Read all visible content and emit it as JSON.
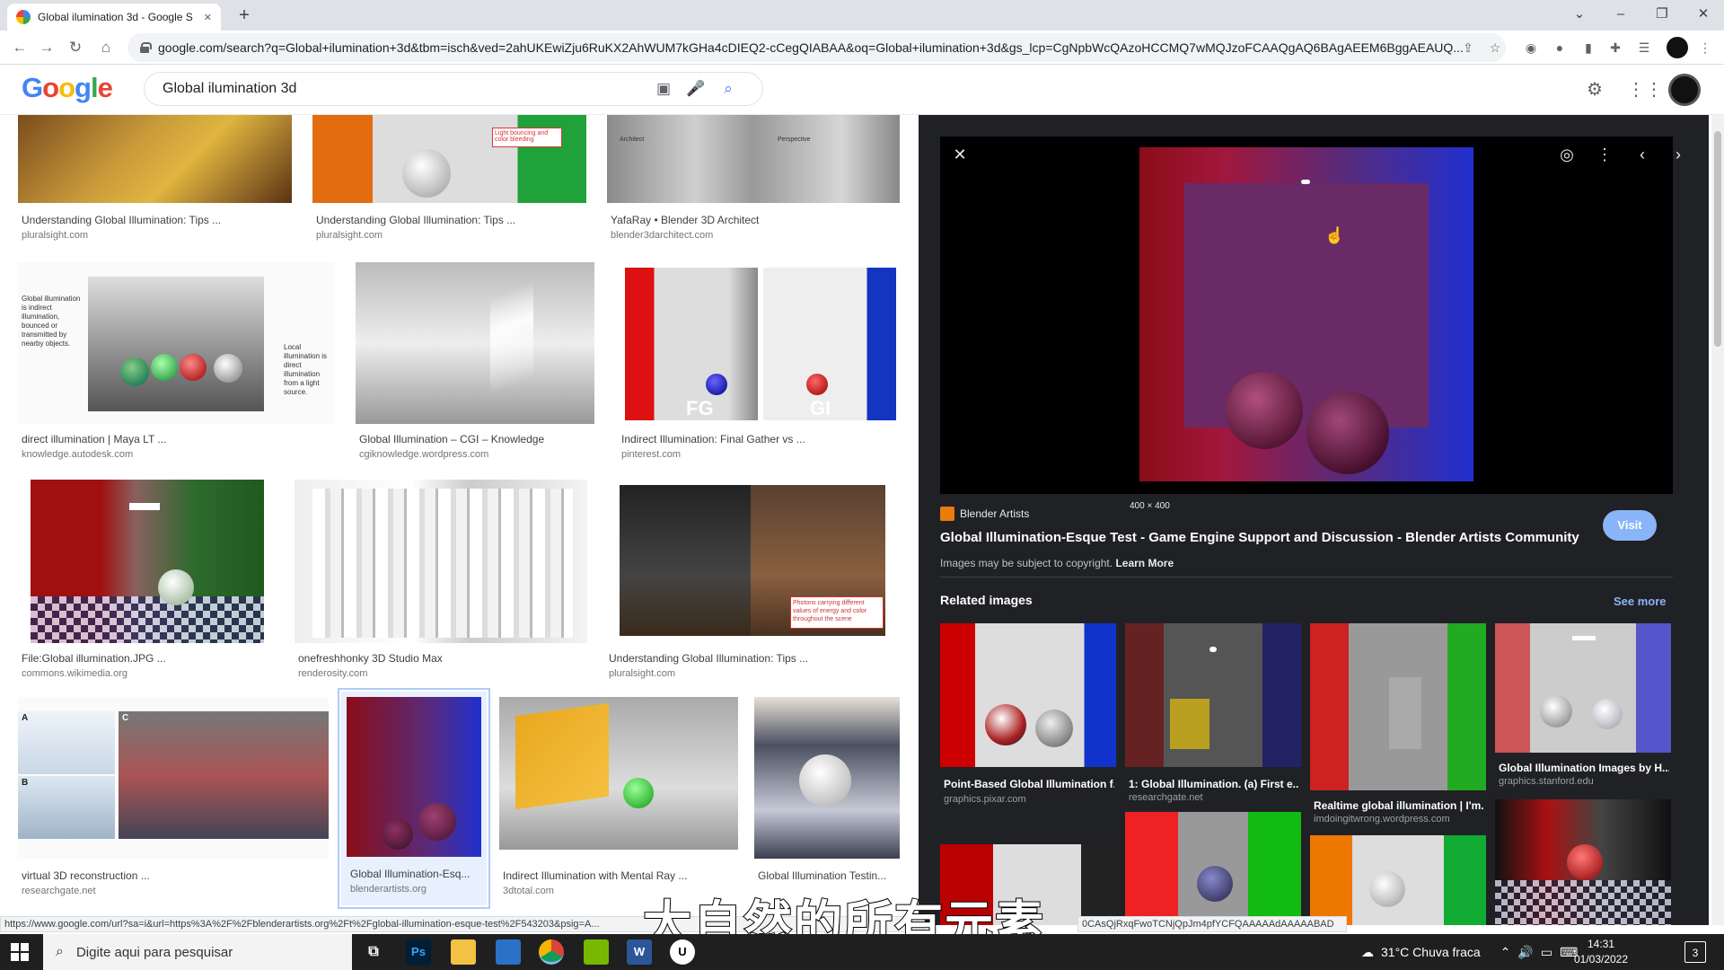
{
  "browser": {
    "tab_title": "Global ilumination 3d - Google S",
    "tab_close": "✕",
    "new_tab": "+",
    "url": "google.com/search?q=Global+ilumination+3d&tbm=isch&ved=2ahUKEwiZju6RuKX2AhWUM7kGHa4cDIEQ2-cCegQIABAA&oq=Global+ilumination+3d&gs_lcp=CgNpbWcQAzoHCCMQ7wMQJzoFCAAQgAQ6BAgAEEM6BggAEAUQ...",
    "window_controls": [
      "⌄",
      "–",
      "❐",
      "✕"
    ],
    "nav": [
      "←",
      "→",
      "↻",
      "⌂"
    ]
  },
  "google": {
    "logo_letters": [
      {
        "ch": "G",
        "color": "#4285f4"
      },
      {
        "ch": "o",
        "color": "#ea4335"
      },
      {
        "ch": "o",
        "color": "#fbbc05"
      },
      {
        "ch": "g",
        "color": "#4285f4"
      },
      {
        "ch": "l",
        "color": "#34a853"
      },
      {
        "ch": "e",
        "color": "#ea4335"
      }
    ],
    "query": "Global ilumination 3d"
  },
  "results": [
    {
      "title": "Understanding Global Illumination: Tips ...",
      "source": "pluralsight.com"
    },
    {
      "title": "Understanding Global Illumination: Tips ...",
      "source": "pluralsight.com"
    },
    {
      "title": "YafaRay • Blender 3D Architect",
      "source": "blender3darchitect.com"
    },
    {
      "title": "direct illumination | Maya LT ...",
      "source": "knowledge.autodesk.com"
    },
    {
      "title": "Global Illumination – CGI – Knowledge",
      "source": "cgiknowledge.wordpress.com"
    },
    {
      "title": "Indirect Illumination: Final Gather vs ...",
      "source": "pinterest.com"
    },
    {
      "title": "File:Global illumination.JPG ...",
      "source": "commons.wikimedia.org"
    },
    {
      "title": "onefreshhonky 3D Studio Max",
      "source": "renderosity.com"
    },
    {
      "title": "Understanding Global Illumination: Tips ...",
      "source": "pluralsight.com"
    },
    {
      "title": "virtual 3D reconstruction ...",
      "source": "researchgate.net"
    },
    {
      "title": "Global Illumination-Esq...",
      "source": "blenderartists.org"
    },
    {
      "title": "Indirect Illumination with Mental Ray ...",
      "source": "3dtotal.com"
    },
    {
      "title": "Global Illumination Testin...",
      "source": ""
    }
  ],
  "image_texts": {
    "bouncing_note": "Light bouncing and color bleeding",
    "yafaray_left": "Architect",
    "yafaray_right": "Perspective",
    "gi_left": "Global illumination is indirect illumination, bounced or transmitted by nearby objects.",
    "gi_right": "Local illumination is direct illumination from a light source.",
    "fg": "FG",
    "gi": "GI",
    "photons": "Photons carrying different values of energy and color throughout the scene",
    "lbl_a": "A",
    "lbl_b": "B",
    "lbl_c": "C"
  },
  "panel": {
    "dims": "400 × 400",
    "source_name": "Blender Artists",
    "title": "Global Illumination-Esque Test - Game Engine Support and Discussion - Blender Artists Community",
    "visit": "Visit",
    "copyright": "Images may be subject to copyright.",
    "learn_more": "Learn More",
    "related_header": "Related images",
    "see_more": "See more",
    "related": [
      {
        "title": "Point-Based Global Illumination f...",
        "source": "graphics.pixar.com"
      },
      {
        "title": "1: Global Illumination. (a) First e...",
        "source": "researchgate.net"
      },
      {
        "title": "Realtime global illumination | I'm...",
        "source": "imdoingitwrong.wordpress.com"
      },
      {
        "title": "Global Illumination Images by H...",
        "source": "graphics.stanford.edu"
      }
    ]
  },
  "status_url": "https://www.google.com/url?sa=i&url=https%3A%2F%2Fblenderartists.org%2Ft%2Fglobal-illumination-esque-test%2F543203&psig=A...",
  "status_url_tail": "0CAsQjRxqFwoTCNjQpJm4pfYCFQAAAAAdAAAAABAD",
  "subtitle": "大自然的所有元素",
  "taskbar": {
    "search_placeholder": "Digite aqui para pesquisar",
    "weather": "31°C  Chuva fraca",
    "time": "14:31",
    "date": "01/03/2022",
    "apps": [
      "Ps",
      "W",
      "U"
    ],
    "notification_count": "3"
  }
}
